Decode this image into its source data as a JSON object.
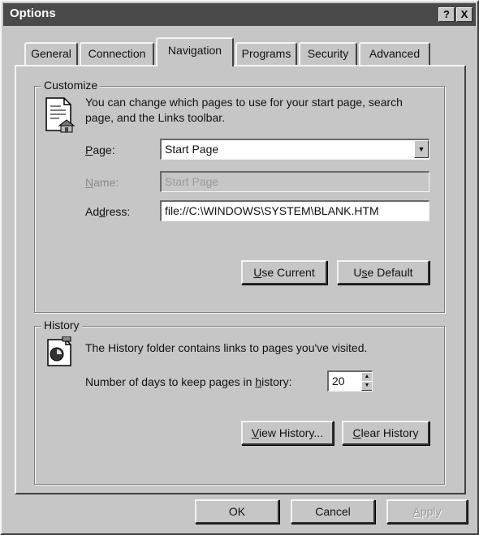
{
  "window": {
    "title": "Options",
    "help_button": "?",
    "close_button": "X"
  },
  "tabs": [
    {
      "label": "General",
      "active": false
    },
    {
      "label": "Connection",
      "active": false
    },
    {
      "label": "Navigation",
      "active": true
    },
    {
      "label": "Programs",
      "active": false
    },
    {
      "label": "Security",
      "active": false
    },
    {
      "label": "Advanced",
      "active": false
    }
  ],
  "customize": {
    "group_label": "Customize",
    "description": "You can change which pages to use for your start page, search page, and the Links toolbar.",
    "page_label_key": "P",
    "page_label_rest": "age:",
    "page_value": "Start Page",
    "name_label_key": "N",
    "name_label_rest": "ame:",
    "name_value": "Start Page",
    "address_label_pre": "Ad",
    "address_label_key": "d",
    "address_label_rest": "ress:",
    "address_value": "file://C:\\WINDOWS\\SYSTEM\\BLANK.HTM",
    "use_current_key": "U",
    "use_current_rest": "se Current",
    "use_default_pre": "U",
    "use_default_key": "s",
    "use_default_rest": "e Default"
  },
  "history": {
    "group_label": "History",
    "description": "The History folder contains links to pages you've visited.",
    "days_label_pre": "Number of days to keep pages in ",
    "days_label_key": "h",
    "days_label_rest": "istory:",
    "days_value": "20",
    "view_history_key": "V",
    "view_history_rest": "iew History...",
    "clear_history_key": "C",
    "clear_history_rest": "lear History"
  },
  "footer": {
    "ok": "OK",
    "cancel": "Cancel",
    "apply_key": "A",
    "apply_rest": "pply"
  },
  "colors": {
    "face": "#c6c6c6",
    "titlebar": "#4a4a4a"
  }
}
